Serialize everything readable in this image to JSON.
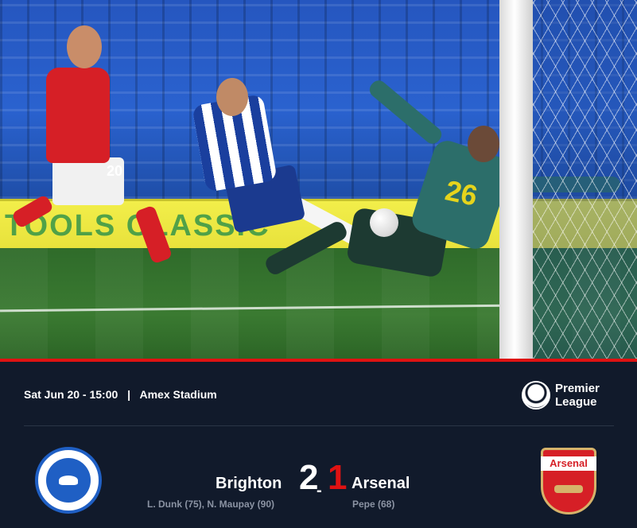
{
  "match": {
    "date_time": "Sat Jun 20 - 15:00",
    "separator": "|",
    "venue": "Amex Stadium"
  },
  "competition": {
    "logo_line1": "Premier",
    "logo_line2": "League",
    "logo_icon": "premier-league-lion-icon"
  },
  "home": {
    "name": "Brighton",
    "score": "2",
    "scorers": "L. Dunk (75), N. Maupay (90)",
    "crest_icon": "brighton-crest-icon",
    "color": "#1f5fc4"
  },
  "score_separator": "-",
  "away": {
    "name": "Arsenal",
    "score": "1",
    "scorers": "Pepe (68)",
    "crest_icon": "arsenal-crest-icon",
    "crest_text": "Arsenal",
    "color": "#d61f26"
  },
  "photo": {
    "adboard_text": "TOOLS CLASSIC",
    "arsenal_player_number": "20",
    "keeper_number": "26"
  },
  "colors": {
    "accent": "#e01212",
    "panel_bg": "#111a2b",
    "muted_text": "#8b93a3"
  }
}
